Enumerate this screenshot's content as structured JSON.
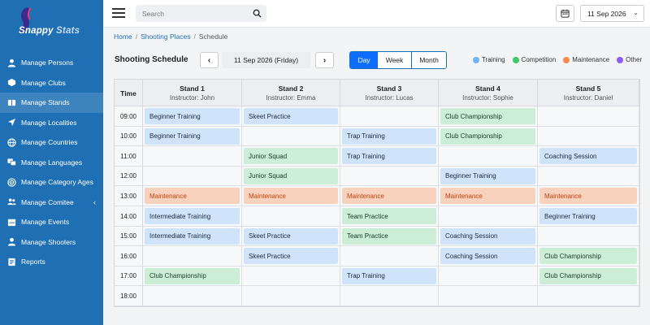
{
  "app": {
    "logo_main": "Snappy ",
    "logo_accent": "Stats"
  },
  "sidebar": {
    "items": [
      {
        "label": "Manage Persons",
        "icon": "user-icon",
        "active": false
      },
      {
        "label": "Manage Clubs",
        "icon": "box-icon",
        "active": false
      },
      {
        "label": "Manage Stands",
        "icon": "stands-icon",
        "active": true
      },
      {
        "label": "Manage Localities",
        "icon": "location-arrow-icon",
        "active": false
      },
      {
        "label": "Manage Countries",
        "icon": "globe-icon",
        "active": false
      },
      {
        "label": "Manage Languages",
        "icon": "language-icon",
        "active": false
      },
      {
        "label": "Manage Category Ages",
        "icon": "target-icon",
        "active": false
      },
      {
        "label": "Manage Comitee",
        "icon": "users-icon",
        "active": false,
        "chevron": "‹"
      },
      {
        "label": "Manage Events",
        "icon": "calendar-icon",
        "active": false
      },
      {
        "label": "Manage Shooters",
        "icon": "user-icon",
        "active": false
      },
      {
        "label": "Reports",
        "icon": "report-icon",
        "active": false
      }
    ]
  },
  "topbar": {
    "search_placeholder": "Search",
    "date_value": "11 Sep 2026"
  },
  "breadcrumb": {
    "home": "Home",
    "places": "Shooting Places",
    "current": "Schedule"
  },
  "schedule": {
    "title": "Shooting Schedule",
    "prev": "‹",
    "next": "›",
    "date_label": "11 Sep 2026 (Friday)",
    "views": {
      "day": "Day",
      "week": "Week",
      "month": "Month"
    },
    "legend": [
      {
        "label": "Training",
        "color": "#6db6f2"
      },
      {
        "label": "Competition",
        "color": "#3dc96a"
      },
      {
        "label": "Maintenance",
        "color": "#f7894a"
      },
      {
        "label": "Other",
        "color": "#8b5cf6"
      }
    ],
    "time_header": "Time",
    "stands": [
      {
        "name": "Stand 1",
        "instructor": "Instructor: John"
      },
      {
        "name": "Stand 2",
        "instructor": "Instructor: Emma"
      },
      {
        "name": "Stand 3",
        "instructor": "Instructor: Lucas"
      },
      {
        "name": "Stand 4",
        "instructor": "Instructor: Sophie"
      },
      {
        "name": "Stand 5",
        "instructor": "Instructor: Daniel"
      }
    ],
    "rows": [
      {
        "time": "09:00",
        "cells": [
          {
            "t": "Beginner Training",
            "k": "training"
          },
          {
            "t": "Skeet Practice",
            "k": "training"
          },
          null,
          {
            "t": "Club Championship",
            "k": "competition"
          },
          null
        ]
      },
      {
        "time": "10:00",
        "cells": [
          {
            "t": "Beginner Training",
            "k": "training"
          },
          null,
          {
            "t": "Trap Training",
            "k": "training"
          },
          {
            "t": "Club Championship",
            "k": "competition"
          },
          null
        ]
      },
      {
        "time": "11:00",
        "cells": [
          null,
          {
            "t": "Junior Squad",
            "k": "competition"
          },
          {
            "t": "Trap Training",
            "k": "training"
          },
          null,
          {
            "t": "Coaching Session",
            "k": "training"
          }
        ]
      },
      {
        "time": "12:00",
        "cells": [
          null,
          {
            "t": "Junior Squad",
            "k": "competition"
          },
          null,
          {
            "t": "Beginner Training",
            "k": "training"
          },
          null
        ]
      },
      {
        "time": "13:00",
        "cells": [
          {
            "t": "Maintenance",
            "k": "maintenance"
          },
          {
            "t": "Maintenance",
            "k": "maintenance"
          },
          {
            "t": "Maintenance",
            "k": "maintenance"
          },
          {
            "t": "Maintenance",
            "k": "maintenance"
          },
          {
            "t": "Maintenance",
            "k": "maintenance"
          }
        ]
      },
      {
        "time": "14:00",
        "cells": [
          {
            "t": "Intermediate Training",
            "k": "training"
          },
          null,
          {
            "t": "Team Practice",
            "k": "competition"
          },
          null,
          {
            "t": "Beginner Training",
            "k": "training"
          }
        ]
      },
      {
        "time": "15:00",
        "cells": [
          {
            "t": "Intermediate Training",
            "k": "training"
          },
          {
            "t": "Skeet Practice",
            "k": "training"
          },
          {
            "t": "Team Practice",
            "k": "competition"
          },
          {
            "t": "Coaching Session",
            "k": "training"
          },
          null
        ]
      },
      {
        "time": "16:00",
        "cells": [
          null,
          {
            "t": "Skeet Practice",
            "k": "training"
          },
          null,
          {
            "t": "Coaching Session",
            "k": "training"
          },
          {
            "t": "Club Championship",
            "k": "competition"
          }
        ]
      },
      {
        "time": "17:00",
        "cells": [
          {
            "t": "Club Championship",
            "k": "competition"
          },
          null,
          {
            "t": "Trap Training",
            "k": "training"
          },
          null,
          {
            "t": "Club Championship",
            "k": "competition"
          }
        ]
      },
      {
        "time": "18:00",
        "cells": [
          null,
          null,
          null,
          null,
          null
        ]
      }
    ]
  }
}
